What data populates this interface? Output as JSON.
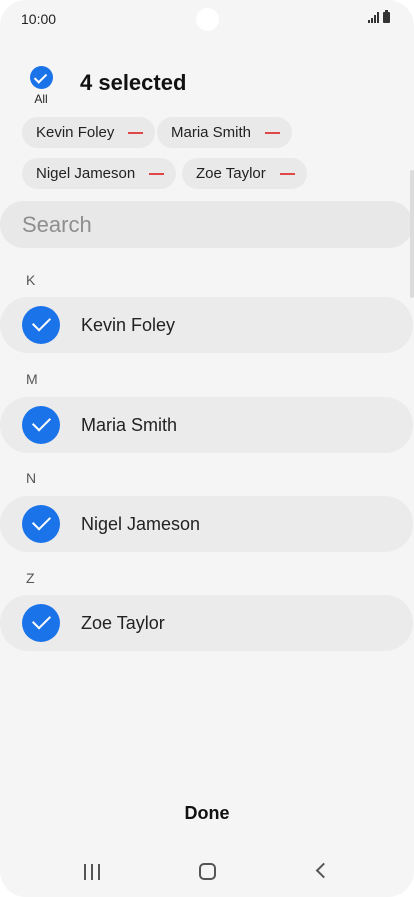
{
  "status_bar": {
    "time": "10:00"
  },
  "header": {
    "select_all_label": "All",
    "selected_count": "4 selected"
  },
  "chips": [
    {
      "label": "Kevin Foley"
    },
    {
      "label": "Maria Smith"
    },
    {
      "label": "Nigel Jameson"
    },
    {
      "label": "Zoe Taylor"
    }
  ],
  "search": {
    "placeholder": "Search",
    "value": ""
  },
  "contacts": [
    {
      "section": "K",
      "name": "Kevin Foley",
      "checked": true
    },
    {
      "section": "M",
      "name": "Maria Smith",
      "checked": true
    },
    {
      "section": "N",
      "name": "Nigel Jameson",
      "checked": true
    },
    {
      "section": "Z",
      "name": "Zoe Taylor",
      "checked": true
    }
  ],
  "footer": {
    "done_label": "Done"
  },
  "colors": {
    "accent": "#1a73e8",
    "remove": "#e04848",
    "background": "#f5f5f5"
  },
  "icons": [
    "signal-icon",
    "battery-icon",
    "check-icon",
    "remove-icon",
    "recent-apps-icon",
    "home-icon",
    "back-icon"
  ]
}
